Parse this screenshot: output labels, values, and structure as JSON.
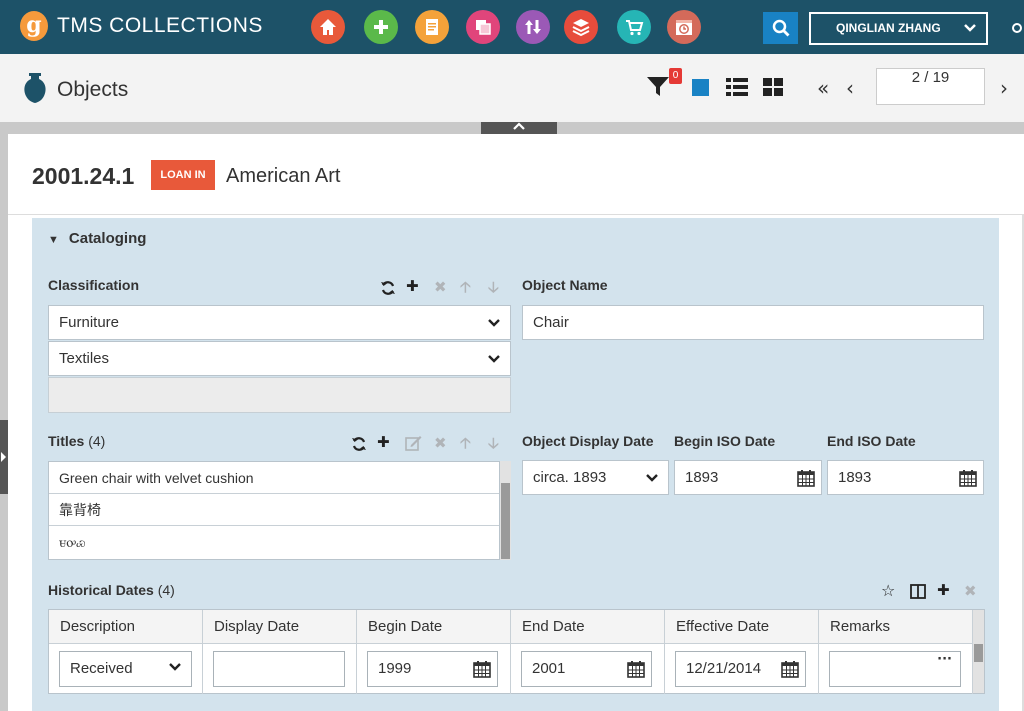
{
  "app": {
    "logo_letter": "g",
    "title": "TMS COLLECTIONS"
  },
  "nav_icons": [
    {
      "name": "home-icon",
      "color": "#e8593a"
    },
    {
      "name": "add-icon",
      "color": "#5bb94a"
    },
    {
      "name": "document-icon",
      "color": "#f4a23a"
    },
    {
      "name": "media-icon",
      "color": "#e0457b"
    },
    {
      "name": "transfer-icon",
      "color": "#9b59b6"
    },
    {
      "name": "layers-icon",
      "color": "#e74c3c"
    },
    {
      "name": "cart-icon",
      "color": "#26b5b5"
    },
    {
      "name": "calendar-clock-icon",
      "color": "#d46a5a"
    }
  ],
  "user": {
    "name": "QINGLIAN ZHANG"
  },
  "module": {
    "title": "Objects"
  },
  "toolbar": {
    "filter_count": "0",
    "page": "2 / 19"
  },
  "record": {
    "number": "2001.24.1",
    "status": "LOAN IN",
    "department": "American Art"
  },
  "cataloging": {
    "title": "Cataloging",
    "classification_label": "Classification",
    "classifications": [
      "Furniture",
      "Textiles"
    ],
    "object_name_label": "Object Name",
    "object_name": "Chair",
    "titles_label": "Titles",
    "titles_count": "(4)",
    "titles": [
      "Green chair with velvet cushion",
      "靠背椅",
      "ꮜꭴꮿ"
    ],
    "display_date_label": "Object Display Date",
    "display_date": "circa. 1893",
    "begin_iso_label": "Begin ISO Date",
    "begin_iso": "1893",
    "end_iso_label": "End ISO Date",
    "end_iso": "1893"
  },
  "historical_dates": {
    "label": "Historical Dates",
    "count": "(4)",
    "columns": [
      "Description",
      "Display Date",
      "Begin Date",
      "End Date",
      "Effective Date",
      "Remarks"
    ],
    "row": {
      "description": "Received",
      "display_date": "",
      "begin_date": "1999",
      "end_date": "2001",
      "effective_date": "12/21/2014",
      "remarks": ""
    }
  }
}
